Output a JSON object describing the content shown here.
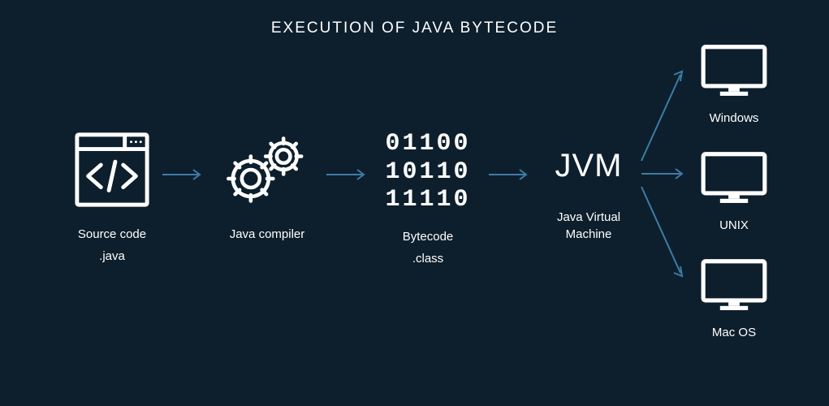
{
  "title": "EXECUTION OF JAVA BYTECODE",
  "stages": {
    "source": {
      "label": "Source code",
      "sublabel": ".java"
    },
    "compiler": {
      "label": "Java compiler"
    },
    "bytecode": {
      "label": "Bytecode",
      "sublabel": ".class",
      "rows": [
        "01100",
        "10110",
        "11110"
      ]
    },
    "jvm": {
      "big": "JVM",
      "label": "Java Virtual Machine"
    }
  },
  "targets": [
    {
      "label": "Windows"
    },
    {
      "label": "UNIX"
    },
    {
      "label": "Mac OS"
    }
  ],
  "icons": {
    "source": "code-window-icon",
    "compiler": "gears-icon",
    "monitor": "monitor-icon"
  },
  "colors": {
    "bg": "#0d1f2d",
    "fg": "#ffffff",
    "arrow": "#3e7ca6"
  }
}
